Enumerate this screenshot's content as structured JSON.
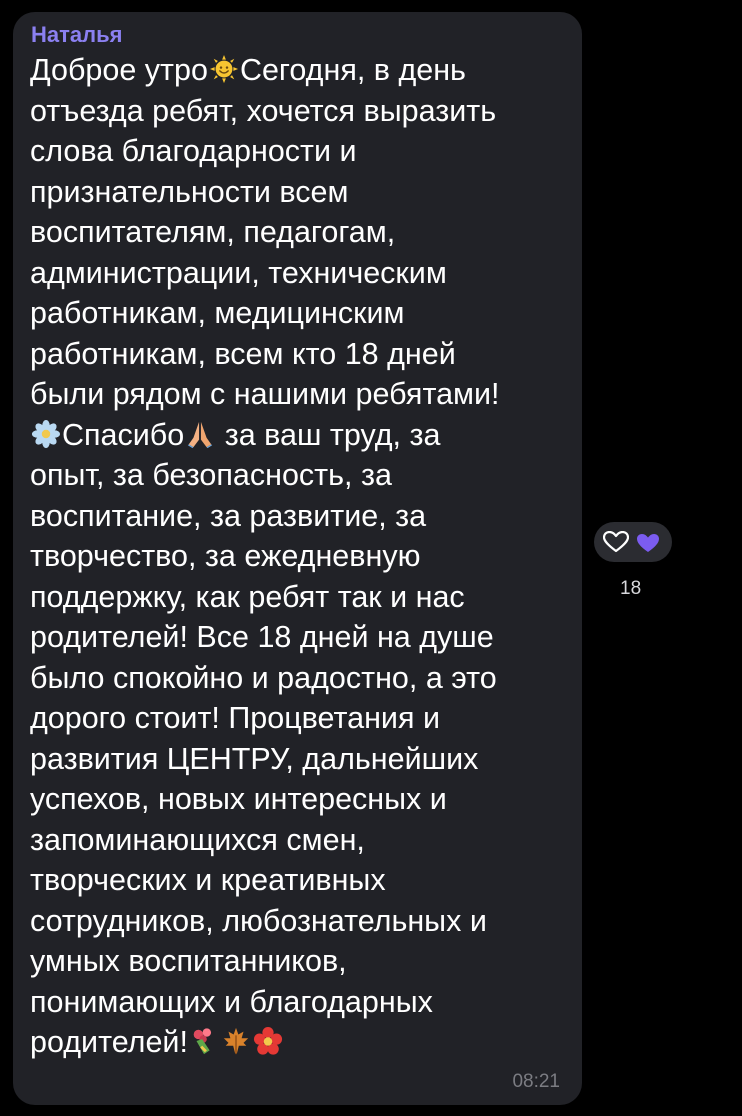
{
  "message": {
    "sender": "Наталья",
    "time": "08:21",
    "lines": [
      {
        "pre": "Доброе утро",
        "emoji": "sun-smile-icon",
        "post": "Сегодня, в день"
      },
      {
        "text": "отъезда ребят, хочется выразить"
      },
      {
        "text": "слова благодарности и"
      },
      {
        "text": "признательности всем"
      },
      {
        "text": "воспитателям, педагогам,"
      },
      {
        "text": "администрации, техническим"
      },
      {
        "text": "работникам, медицинским"
      },
      {
        "text": "работникам, всем кто 18 дней"
      },
      {
        "text": "были рядом с нашими ребятами!"
      },
      {
        "emoji_pre": "blossom-icon",
        "pre": "Спасибо",
        "emoji": "praying-hands-icon",
        "post": " за ваш труд, за"
      },
      {
        "text": "опыт, за безопасность, за"
      },
      {
        "text": "воспитание, за развитие, за"
      },
      {
        "text": "творчество, за ежедневную"
      },
      {
        "text": "поддержку, как ребят так и нас"
      },
      {
        "text": "родителей! Все 18 дней на душе"
      },
      {
        "text": "было спокойно и радостно, а это"
      },
      {
        "text": "дорого стоит! Процветания и"
      },
      {
        "text": "развития ЦЕНТРУ, дальнейших"
      },
      {
        "text": "успехов, новых интересных и"
      },
      {
        "text": "запоминающихся смен,"
      },
      {
        "text": "творческих и креативных"
      },
      {
        "text": "сотрудников, любознательных и"
      },
      {
        "text": "умных воспитанников,"
      },
      {
        "text": "понимающих и благодарных"
      },
      {
        "pre": "родителей!",
        "emojis_after": [
          "bouquet-icon",
          "maple-leaf-icon",
          "flower-icon"
        ]
      }
    ]
  },
  "reactions": {
    "icons": [
      "heart-outline-icon",
      "purple-heart-icon"
    ],
    "count": "18",
    "colors": {
      "accent": "#8b80f0",
      "heart": "#7b5cf0"
    }
  }
}
